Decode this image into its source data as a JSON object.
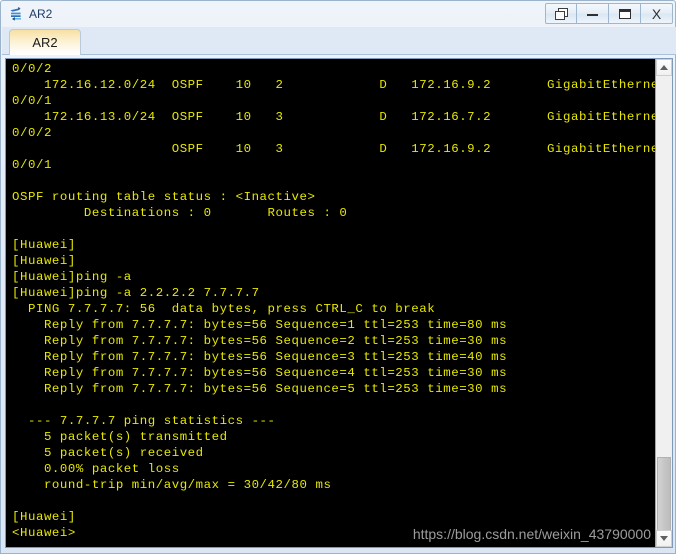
{
  "window": {
    "title": "AR2",
    "app_icon": "router-icon",
    "buttons": [
      {
        "name": "restore-window-button",
        "icon": "restore-icon",
        "label": ""
      },
      {
        "name": "minimize-window-button",
        "icon": "minimize-icon",
        "label": ""
      },
      {
        "name": "maximize-window-button",
        "icon": "maximize-icon",
        "label": ""
      },
      {
        "name": "close-window-button",
        "icon": "close-icon",
        "label": "X"
      }
    ]
  },
  "tabs": [
    {
      "label": "AR2",
      "active": true
    }
  ],
  "terminal": {
    "foreground_color": "#e8e800",
    "background_color": "#000000",
    "content": "0/0/2\n    172.16.12.0/24  OSPF    10   2            D   172.16.9.2       GigabitEthernet\n0/0/1\n    172.16.13.0/24  OSPF    10   3            D   172.16.7.2       GigabitEthernet\n0/0/2\n                    OSPF    10   3            D   172.16.9.2       GigabitEthernet\n0/0/1\n\nOSPF routing table status : <Inactive>\n         Destinations : 0       Routes : 0\n\n[Huawei]\n[Huawei]\n[Huawei]ping -a\n[Huawei]ping -a 2.2.2.2 7.7.7.7\n  PING 7.7.7.7: 56  data bytes, press CTRL_C to break\n    Reply from 7.7.7.7: bytes=56 Sequence=1 ttl=253 time=80 ms\n    Reply from 7.7.7.7: bytes=56 Sequence=2 ttl=253 time=30 ms\n    Reply from 7.7.7.7: bytes=56 Sequence=3 ttl=253 time=40 ms\n    Reply from 7.7.7.7: bytes=56 Sequence=4 ttl=253 time=30 ms\n    Reply from 7.7.7.7: bytes=56 Sequence=5 ttl=253 time=30 ms\n\n  --- 7.7.7.7 ping statistics ---\n    5 packet(s) transmitted\n    5 packet(s) received\n    0.00% packet loss\n    round-trip min/avg/max = 30/42/80 ms\n\n[Huawei]\n<Huawei>"
  },
  "scrollbar": {
    "up_arrow": "chevron-up-icon",
    "down_arrow": "chevron-down-icon"
  },
  "watermark": {
    "text": "https://blog.csdn.net/weixin_43790000"
  }
}
